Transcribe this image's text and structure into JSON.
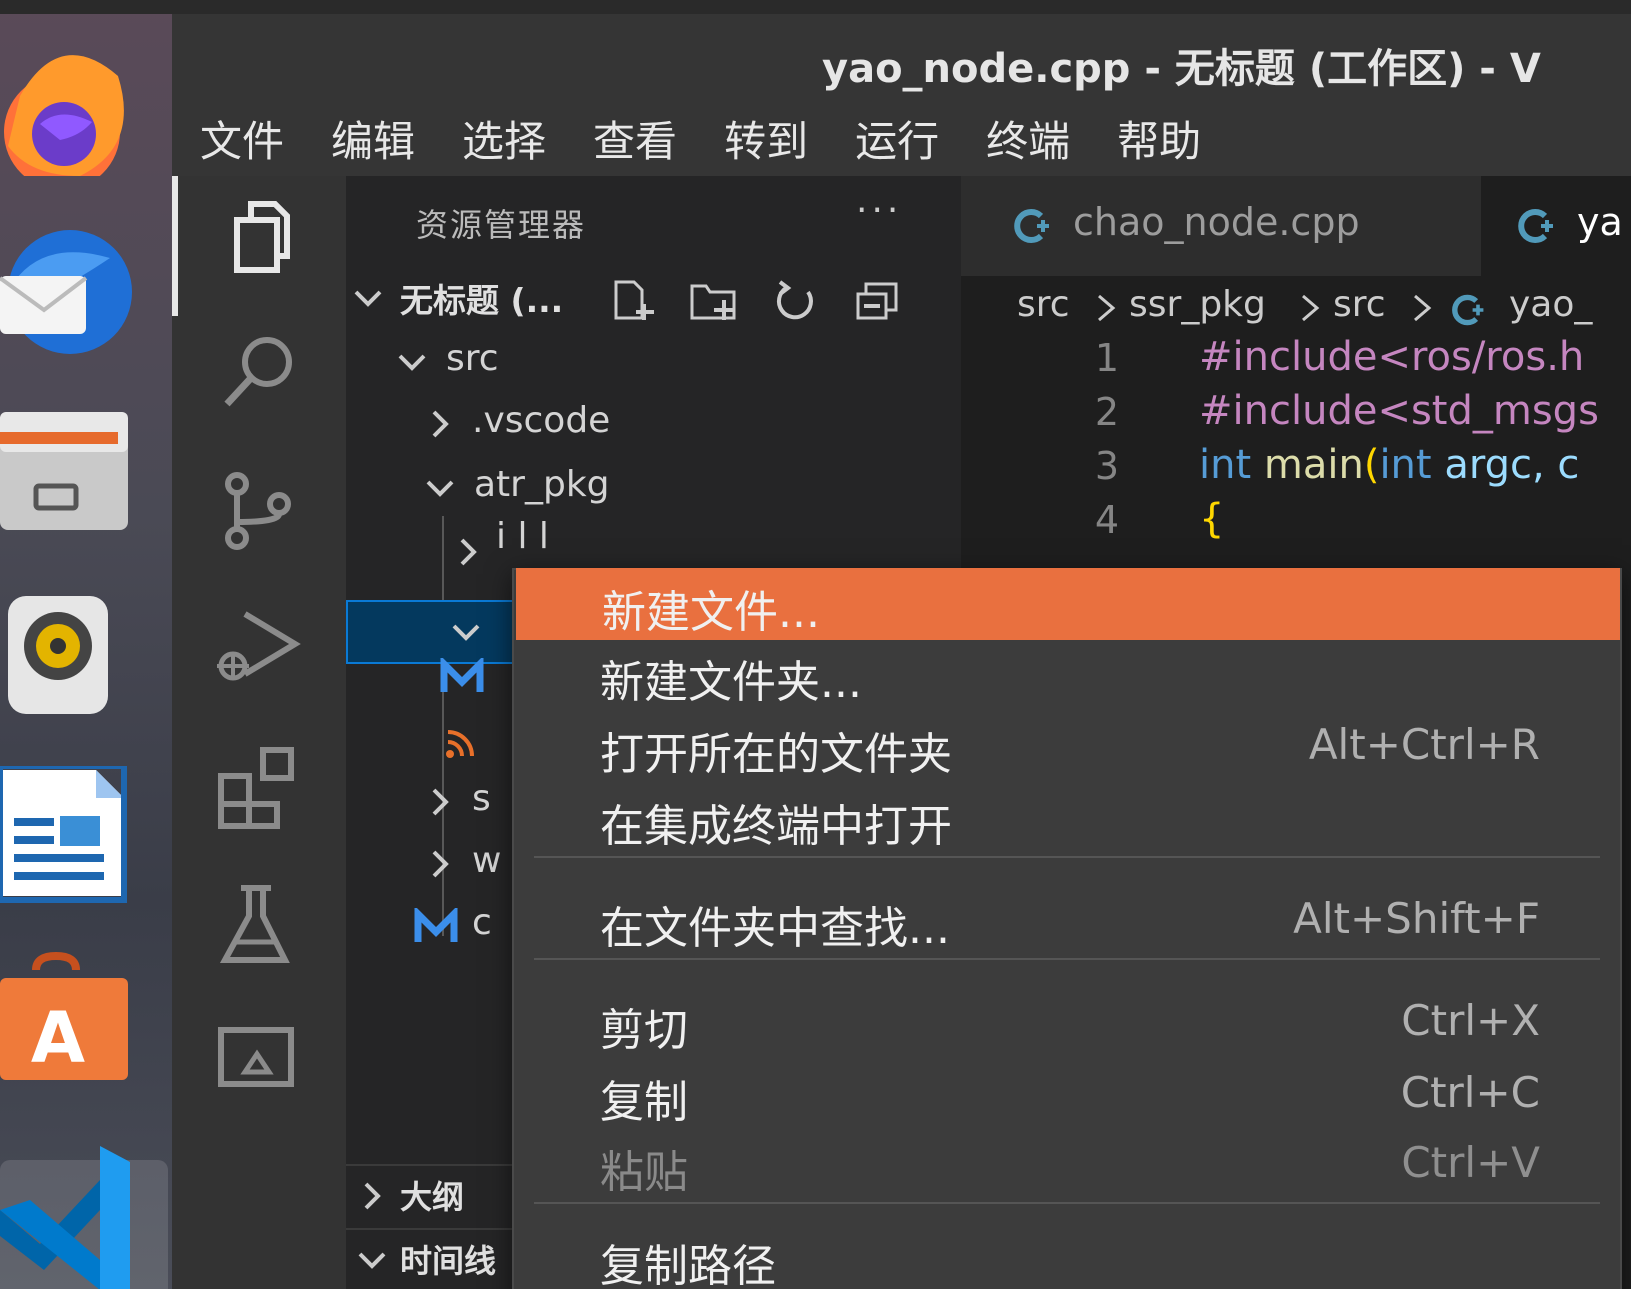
{
  "window": {
    "title": "yao_node.cpp - 无标题 (工作区) - V"
  },
  "menubar": [
    "文件",
    "编辑",
    "选择",
    "查看",
    "转到",
    "运行",
    "终端",
    "帮助"
  ],
  "dock": {
    "apps": [
      "firefox",
      "thunderbird",
      "files",
      "rhythmbox",
      "libreoffice-writer",
      "ubuntu-software",
      "vscode"
    ]
  },
  "activitybar": {
    "icons": [
      "explorer-icon",
      "search-icon",
      "source-control-icon",
      "run-debug-icon",
      "extensions-icon",
      "testing-icon",
      "remote-explorer-icon"
    ]
  },
  "sidebar": {
    "title": "资源管理器",
    "more": "···",
    "workspace": "无标题 (...",
    "tree": {
      "src": "src",
      "vscode": ".vscode",
      "atr_pkg": "atr_pkg",
      "include_partial": "i   l   l",
      "s_partial": "s",
      "w_partial": "w",
      "c_partial": "c"
    },
    "outline": "大纲",
    "timeline": "时间线"
  },
  "editor": {
    "tabs": [
      {
        "label": "chao_node.cpp"
      },
      {
        "label": "ya"
      }
    ],
    "breadcrumb": [
      "src",
      "ssr_pkg",
      "src",
      "yao_"
    ],
    "lines": [
      {
        "no": "1",
        "pp": "#include<ros/ros.h"
      },
      {
        "no": "2",
        "pp": "#include<std_msgs"
      },
      {
        "no": "3",
        "kw1": "int",
        "fn": "main",
        "paren": "(",
        "kw2": "int",
        "var": "argc,",
        "tail": "c"
      },
      {
        "no": "4",
        "brace": "{"
      }
    ]
  },
  "context_menu": {
    "items": [
      {
        "label": "新建文件...",
        "shortcut": "",
        "selected": true
      },
      {
        "label": "新建文件夹...",
        "shortcut": ""
      },
      {
        "label": "打开所在的文件夹",
        "shortcut": "Alt+Ctrl+R"
      },
      {
        "label": "在集成终端中打开",
        "shortcut": ""
      },
      {
        "label": "在文件夹中查找...",
        "shortcut": "Alt+Shift+F"
      },
      {
        "label": "剪切",
        "shortcut": "Ctrl+X"
      },
      {
        "label": "复制",
        "shortcut": "Ctrl+C"
      },
      {
        "label": "粘贴",
        "shortcut": "Ctrl+V",
        "disabled": true
      },
      {
        "label": "复制路径",
        "shortcut": ""
      }
    ]
  },
  "colors": {
    "accent": "#e9703f",
    "selection": "#04395e",
    "editor_bg": "#1e1e1e"
  }
}
